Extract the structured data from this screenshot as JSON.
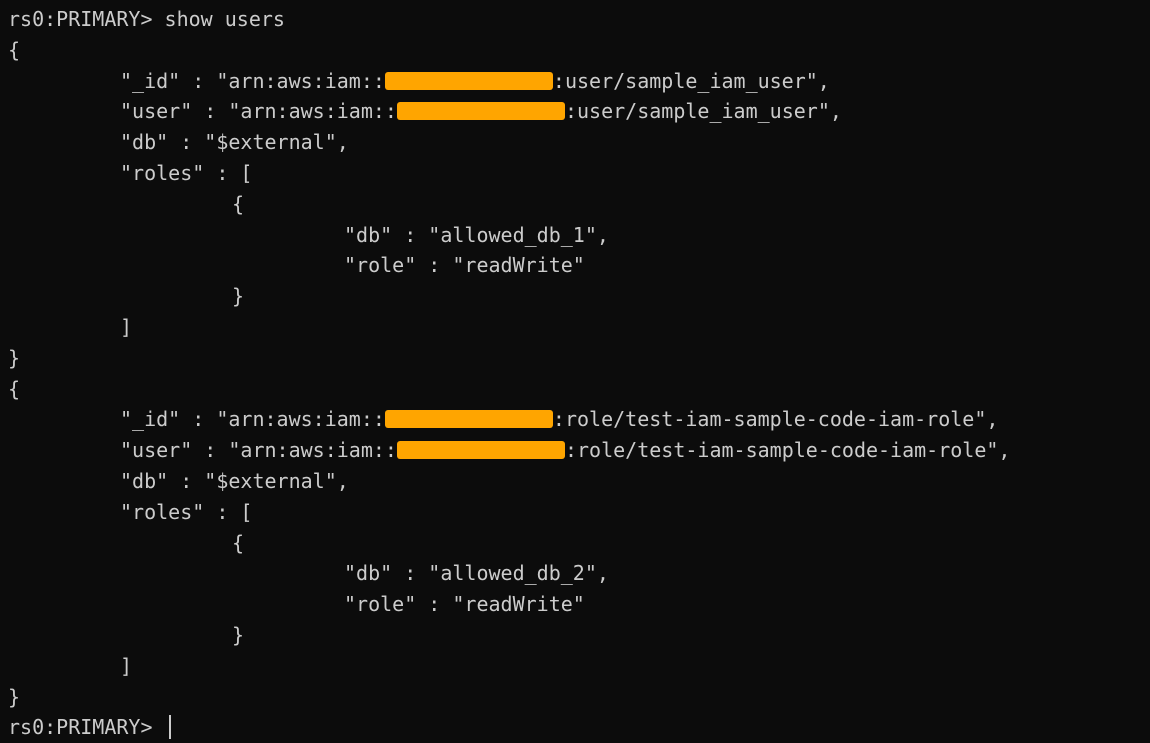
{
  "terminal": {
    "prompt": "rs0:PRIMARY>",
    "command": "show users",
    "background_color": "#0c0c0c",
    "text_color": "#cccccc",
    "redaction_color": "#ffa500"
  },
  "users": [
    {
      "open_brace": "{",
      "id_prefix": "\"_id\" : \"arn:aws:iam::",
      "id_suffix": ":user/sample_iam_user\",",
      "user_prefix": "\"user\" : \"arn:aws:iam::",
      "user_suffix": ":user/sample_iam_user\",",
      "db_line": "\"db\" : \"$external\",",
      "roles_open": "\"roles\" : [",
      "role_open": "{",
      "role_db": "\"db\" : \"allowed_db_1\",",
      "role_role": "\"role\" : \"readWrite\"",
      "role_close": "}",
      "roles_close": "]",
      "close_brace": "}"
    },
    {
      "open_brace": "{",
      "id_prefix": "\"_id\" : \"arn:aws:iam::",
      "id_suffix": ":role/test-iam-sample-code-iam-role\",",
      "user_prefix": "\"user\" : \"arn:aws:iam::",
      "user_suffix": ":role/test-iam-sample-code-iam-role\",",
      "db_line": "\"db\" : \"$external\",",
      "roles_open": "\"roles\" : [",
      "role_open": "{",
      "role_db": "\"db\" : \"allowed_db_2\",",
      "role_role": "\"role\" : \"readWrite\"",
      "role_close": "}",
      "roles_close": "]",
      "close_brace": "}"
    }
  ]
}
